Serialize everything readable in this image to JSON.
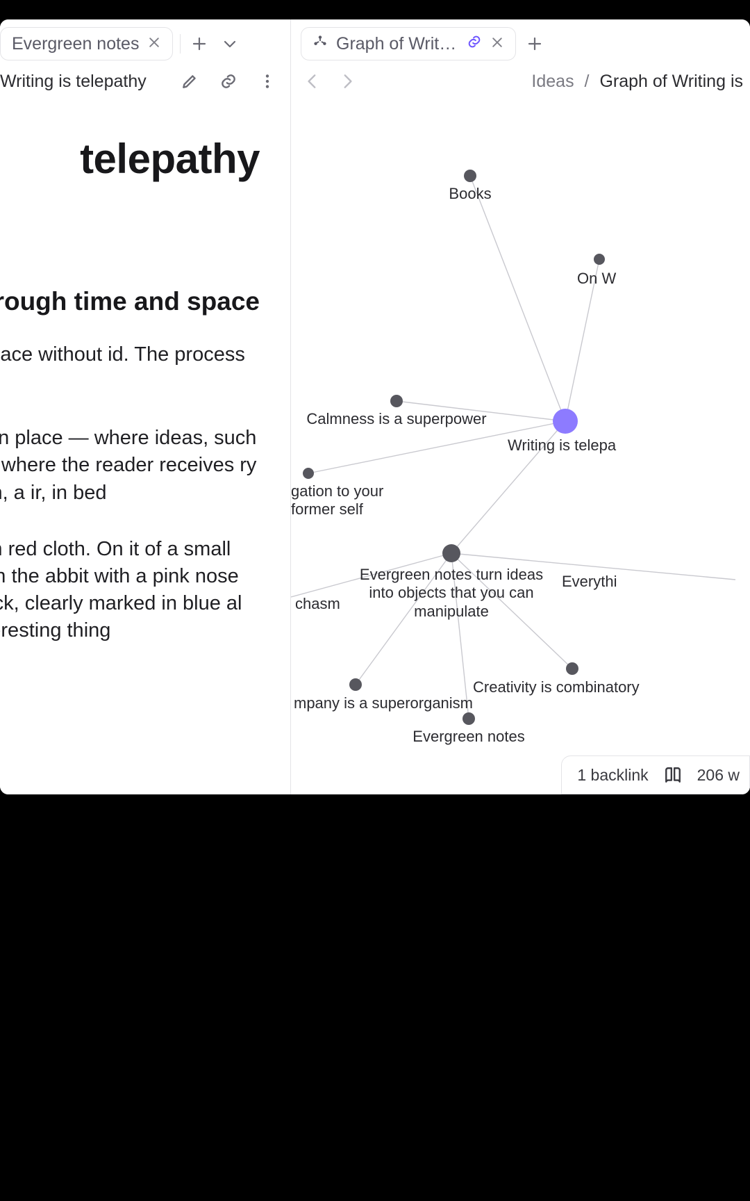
{
  "left": {
    "tab": {
      "title": "Evergreen notes"
    },
    "breadcrumb": "Writing is telepathy",
    "note": {
      "title": "telepathy",
      "h2": "through time and space",
      "p1": "ugh time and space without id. The process of telepathy",
      "p2": "e, a transmission place — where ideas, such as a desk ce — where the reader receives ry such as a couch, a ir, in bed",
      "p3": "ble covered with red cloth. On it of a small fish aquarium. In the abbit with a pink nose and pink- its back, clearly marked in blue al 8. The most interesting thing"
    }
  },
  "right": {
    "tab": {
      "title": "Graph of Writing is t"
    },
    "breadcrumb": {
      "root": "Ideas",
      "sep": "/",
      "page": "Graph of Writing is"
    },
    "graph": {
      "nodes": {
        "books": "Books",
        "onw": "On W",
        "calm": "Calmness is a superpower",
        "writing": "Writing is telepa",
        "obligation": "gation to your former self",
        "evergreenIdeas": "Evergreen notes turn ideas into objects that you can manipulate",
        "everything": "Everythi",
        "chasm": "chasm",
        "company": "mpany is a superorganism",
        "creativity": "Creativity is combinatory",
        "evergreen": "Evergreen notes"
      }
    },
    "footer": {
      "backlinks": "1 backlink",
      "words": "206 w"
    }
  }
}
